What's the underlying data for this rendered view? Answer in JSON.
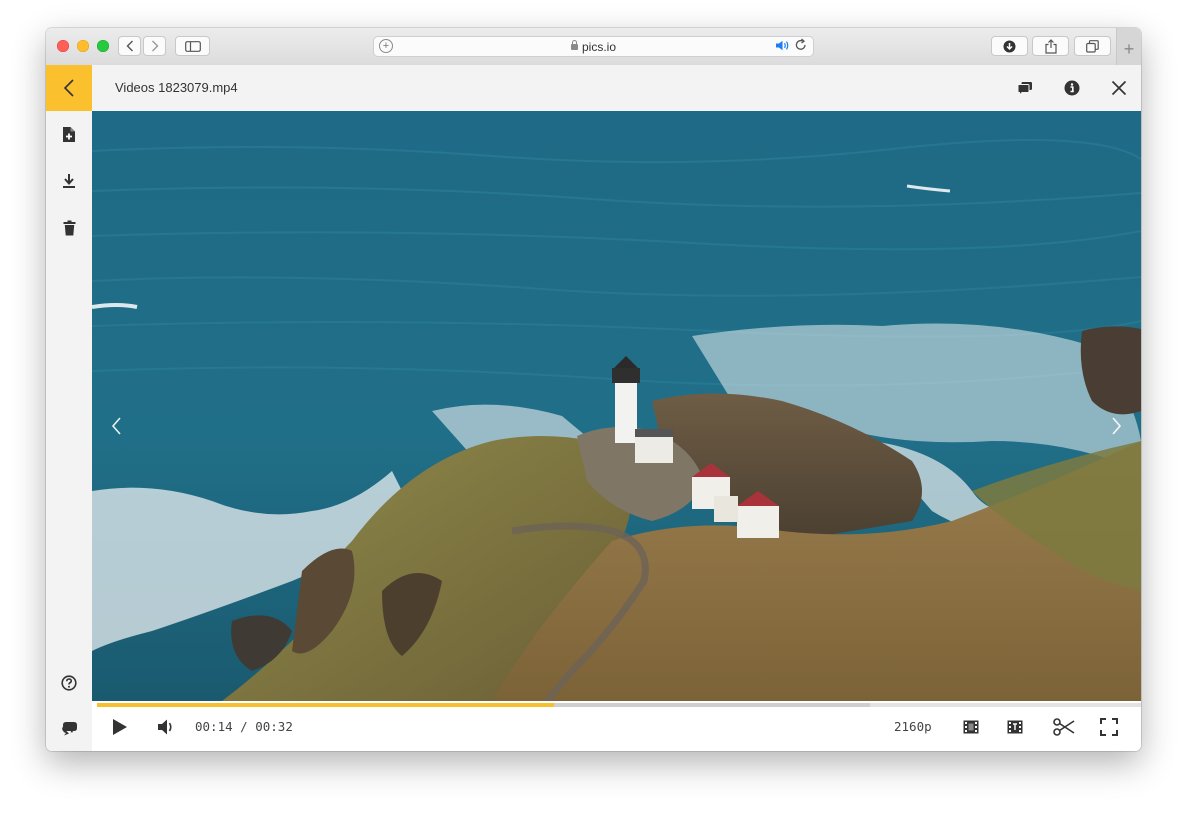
{
  "browser": {
    "address": "pics.io"
  },
  "viewer": {
    "file_name": "Videos 1823079.mp4"
  },
  "player": {
    "current_time": "00:14",
    "duration": "00:32",
    "separator": "/",
    "played_fraction": 0.4375,
    "buffered_fraction": 0.74,
    "quality": "2160p"
  },
  "colors": {
    "accent": "#fbc02d",
    "progress_played": "#f6c02f",
    "sidebar_bg": "#f3f3f3"
  },
  "icons": {
    "sidebar_top": [
      "add-file-icon",
      "download-icon",
      "trash-icon"
    ],
    "sidebar_bottom": [
      "help-icon",
      "chat-icon"
    ],
    "topbar": [
      "comments-icon",
      "info-icon",
      "close-icon"
    ],
    "player": [
      "play-icon",
      "volume-icon",
      "frame-icon",
      "subtitles-icon",
      "scissors-icon",
      "fullscreen-icon"
    ]
  }
}
